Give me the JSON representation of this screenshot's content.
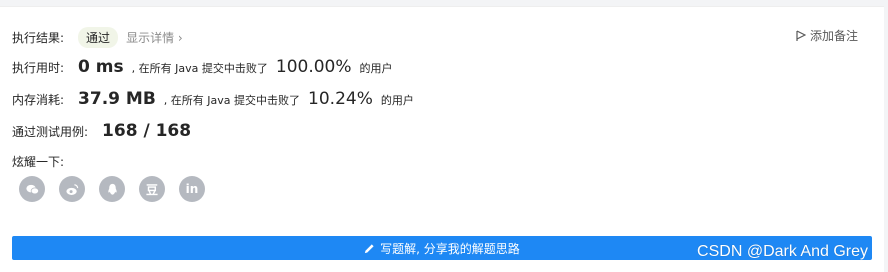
{
  "result": {
    "label": "执行结果:",
    "status": "通过",
    "detail_link": "显示详情 ›"
  },
  "add_note": "添加备注",
  "runtime": {
    "label": "执行用时:",
    "value": "0 ms",
    "prefix": ", 在所有 Java 提交中击败了",
    "percent": "100.00%",
    "suffix": "的用户"
  },
  "memory": {
    "label": "内存消耗:",
    "value": "37.9 MB",
    "prefix": ", 在所有 Java 提交中击败了",
    "percent": "10.24%",
    "suffix": "的用户"
  },
  "testcases": {
    "label": "通过测试用例:",
    "value": "168 / 168"
  },
  "share": {
    "label": "炫耀一下:",
    "icons": [
      "wechat-icon",
      "weibo-icon",
      "qq-icon",
      "douban-icon",
      "linkedin-icon"
    ],
    "douban_text": "豆",
    "linkedin_text": "in"
  },
  "cta_label": "写题解, 分享我的解题思路",
  "watermark": "CSDN @Dark And Grey",
  "colors": {
    "primary": "#1e88f4",
    "badge_bg": "#f1f5e8",
    "icon_bg": "#b5b9c0"
  }
}
